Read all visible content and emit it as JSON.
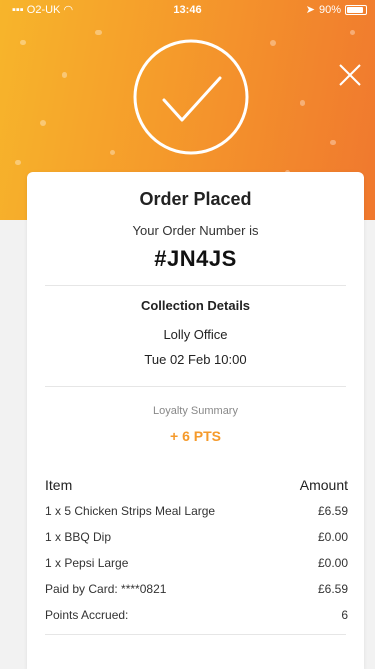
{
  "statusbar": {
    "carrier": "O2-UK",
    "time": "13:46",
    "battery": "90%",
    "battery_level": 0.9
  },
  "header": {
    "close_icon": "close-icon",
    "check_icon": "check-circle-icon"
  },
  "order": {
    "title": "Order Placed",
    "number_label": "Your Order Number is",
    "number": "#JN4JS"
  },
  "collection": {
    "title": "Collection Details",
    "place": "Lolly Office",
    "datetime": "Tue 02 Feb 10:00"
  },
  "loyalty": {
    "title": "Loyalty Summary",
    "points": "+ 6 PTS"
  },
  "items_table": {
    "header_item": "Item",
    "header_amount": "Amount",
    "rows": [
      {
        "item": "1 x 5 Chicken Strips Meal Large",
        "amount": "£6.59"
      },
      {
        "item": "1 x BBQ Dip",
        "amount": "£0.00"
      },
      {
        "item": "1 x Pepsi Large",
        "amount": "£0.00"
      },
      {
        "item": "Paid by Card: ****0821",
        "amount": "£6.59"
      },
      {
        "item": "Points Accrued:",
        "amount": "6"
      }
    ]
  },
  "colors": {
    "accent": "#f59a2b",
    "hero_start": "#f7b52b",
    "hero_end": "#f0782e"
  }
}
